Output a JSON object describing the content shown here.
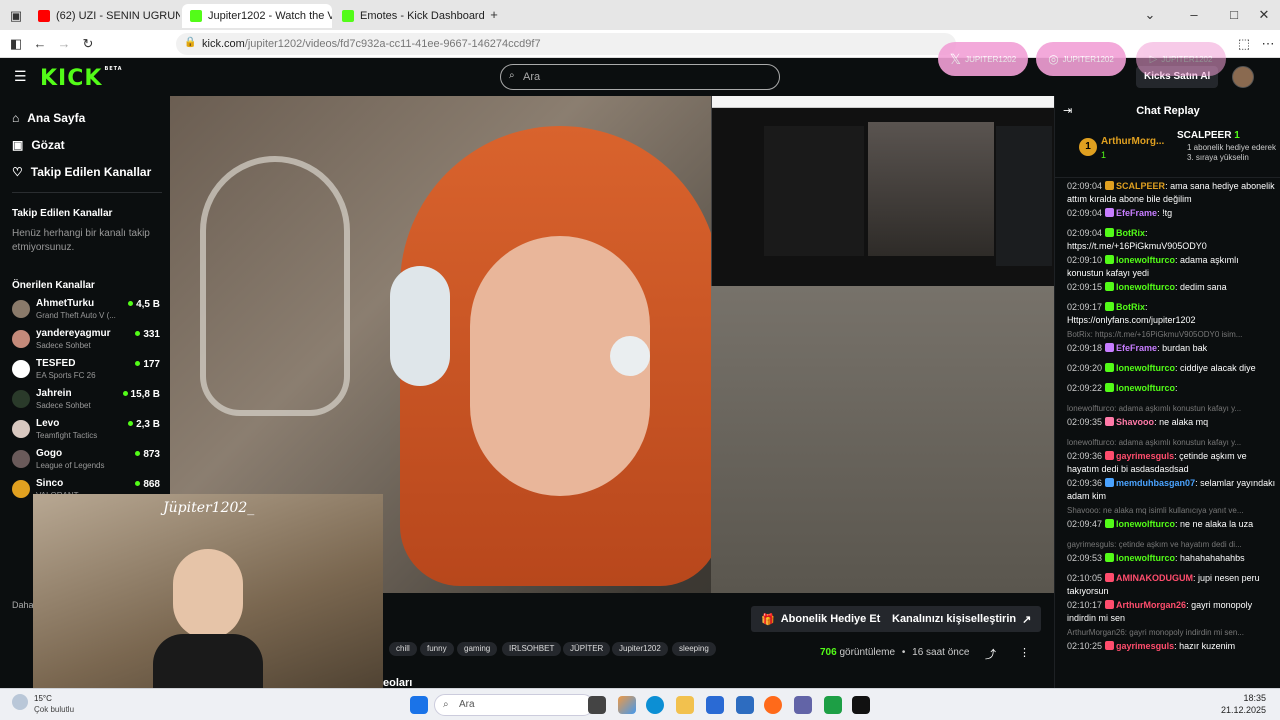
{
  "browser": {
    "tabs": [
      {
        "title": "(62) UZI - SENIN UGRUNA FT M",
        "favicon_color": "#ff0000"
      },
      {
        "title": "Jupiter1202 - Watch the VO",
        "favicon_color": "#53fc18"
      },
      {
        "title": "Emotes - Kick Dashboard",
        "favicon_color": "#53fc18"
      }
    ],
    "new_tab": "+",
    "url_host": "kick.com",
    "url_path": "/jupiter1202/videos/fd7c932a-cc11-41ee-9667-146274ccd9f7",
    "window_controls": [
      "–",
      "□",
      "✕"
    ]
  },
  "header": {
    "logo": "KICK",
    "logo_sup": "BETA",
    "search_placeholder": "Ara",
    "overlay_buttons": [
      "JUPITER1202",
      "JUPITER1202",
      "JUPITER1202"
    ],
    "subscribe_label": "Kicks Satın Al"
  },
  "sidebar": {
    "nav": [
      {
        "label": "Ana Sayfa",
        "icon": "home-icon"
      },
      {
        "label": "Gözat",
        "icon": "browse-icon"
      },
      {
        "label": "Takip Edilen Kanallar",
        "icon": "heart-icon"
      }
    ],
    "followed_title": "Takip Edilen Kanallar",
    "followed_empty": "Henüz herhangi bir kanalı takip etmiyorsunuz.",
    "recommended_title": "Önerilen Kanallar",
    "channels": [
      {
        "name": "AhmetTurku",
        "category": "Grand Theft Auto V (...",
        "viewers": "4,5 B",
        "color": "#8a7a6a"
      },
      {
        "name": "yandereyagmur",
        "category": "Sadece Sohbet",
        "viewers": "331",
        "color": "#c48a7a"
      },
      {
        "name": "TESFED",
        "category": "EA Sports FC 26",
        "viewers": "177",
        "color": "#ffffff"
      },
      {
        "name": "Jahrein",
        "category": "Sadece Sohbet",
        "viewers": "15,8 B",
        "color": "#2a3a2a"
      },
      {
        "name": "Levo",
        "category": "Teamfight Tactics",
        "viewers": "2,3 B",
        "color": "#d8c8c0"
      },
      {
        "name": "Gogo",
        "category": "League of Legends",
        "viewers": "873",
        "color": "#6a5a5a"
      },
      {
        "name": "Sinco",
        "category": "VALORANT",
        "viewers": "868",
        "color": "#e0a020"
      }
    ],
    "more_label": "Daha"
  },
  "video": {
    "cam_name": "Jüpiter1202_"
  },
  "info": {
    "gift_button": "Abonelik Hediye Et",
    "customize_button": "Kanalınızı kişiselleştirin",
    "tags": [
      "chill",
      "funny",
      "gaming",
      "IRLSOHBET",
      "JÜPİTER",
      "Jupiter1202",
      "sleeping"
    ],
    "views_count": "706",
    "views_label": "görüntüleme",
    "time_ago": "16 saat önce",
    "partial_title": "eoları"
  },
  "chat": {
    "title": "Chat Replay",
    "pinned": {
      "rank": "1",
      "user1": "ArthurMorg...",
      "user1_count": "1",
      "user2": "SCALPEER",
      "user2_count": "1",
      "subtitle": "1 abonelik hediye ederek 3. sıraya yükselin"
    },
    "messages": [
      {
        "time": "02:09:04",
        "user": "SCALPEER",
        "color": "#e0a020",
        "text": ": ama sana hediye abonelik attım kıralda abone bile değilim"
      },
      {
        "time": "02:09:04",
        "user": "EfeFrame",
        "color": "#c77dff",
        "text": ": !tg"
      },
      {
        "time": "02:09:04",
        "user": "BotRix",
        "color": "#53fc18",
        "text": ": https://t.me/+16PiGkmuV905ODY0"
      },
      {
        "time": "02:09:10",
        "user": "lonewolfturco",
        "color": "#53fc18",
        "text": ": adama aşkımlı konustun kafayı yedi"
      },
      {
        "time": "02:09:15",
        "user": "lonewolfturco",
        "color": "#53fc18",
        "text": ": dedim sana"
      },
      {
        "time": "02:09:17",
        "user": "BotRix",
        "color": "#53fc18",
        "text": ": Https://onlyfans.com/jupiter1202"
      },
      {
        "reply": "BotRix: https://t.me/+16PiGkmuV905ODY0 isim..."
      },
      {
        "time": "02:09:18",
        "user": "EfeFrame",
        "color": "#c77dff",
        "text": ": burdan bak"
      },
      {
        "time": "02:09:20",
        "user": "lonewolfturco",
        "color": "#53fc18",
        "text": ": ciddiye alacak diye"
      },
      {
        "time": "02:09:22",
        "user": "lonewolfturco",
        "color": "#53fc18",
        "text": ":"
      },
      {
        "reply": "lonewolfturco: adama aşkımlı konustun kafayı y..."
      },
      {
        "time": "02:09:35",
        "user": "Shavooo",
        "color": "#ff7aa8",
        "text": ": ne alaka mq"
      },
      {
        "reply": "lonewolfturco: adama aşkımlı konustun kafayı y..."
      },
      {
        "time": "02:09:36",
        "user": "gayrimesguls",
        "color": "#ff4d6d",
        "text": ": çetinde aşkım ve hayatım dedi bi asdasdasdsad"
      },
      {
        "time": "02:09:36",
        "user": "memduhbasgan07",
        "color": "#4aa3ff",
        "text": ": selamlar yayındakı adam kim"
      },
      {
        "reply": "Shavooo: ne alaka mq isimli kullanıcıya yanıt ve..."
      },
      {
        "time": "02:09:47",
        "user": "lonewolfturco",
        "color": "#53fc18",
        "text": ": ne ne alaka la uza"
      },
      {
        "reply": "gayrimesguls: çetinde aşkım ve hayatım dedi di..."
      },
      {
        "time": "02:09:53",
        "user": "lonewolfturco",
        "color": "#53fc18",
        "text": ": hahahahahahbs"
      },
      {
        "time": "02:10:05",
        "user": "AMINAKODUGUM",
        "color": "#ff4d6d",
        "text": ": jupi nesen peru takıyorsun"
      },
      {
        "time": "02:10:17",
        "user": "ArthurMorgan26",
        "color": "#ff4d6d",
        "text": ": gayri monopoly indirdin mi sen"
      },
      {
        "reply": "ArthurMorgan26: gayri monopoly indirdin mi sen..."
      },
      {
        "time": "02:10:25",
        "user": "gayrimesguls",
        "color": "#ff4d6d",
        "text": ": hazır kuzenim"
      }
    ]
  },
  "taskbar": {
    "weather_temp": "15°C",
    "weather_desc": "Çok bulutlu",
    "search_placeholder": "Ara",
    "time": "18:35",
    "date": "21.12.2025"
  }
}
